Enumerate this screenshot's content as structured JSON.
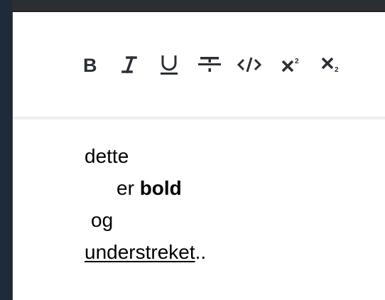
{
  "toolbar": {
    "buttons": [
      {
        "name": "bold",
        "icon": "bold-icon"
      },
      {
        "name": "italic",
        "icon": "italic-icon"
      },
      {
        "name": "underline",
        "icon": "underline-icon"
      },
      {
        "name": "strikethrough",
        "icon": "strikethrough-icon"
      },
      {
        "name": "code",
        "icon": "code-icon"
      },
      {
        "name": "superscript",
        "icon": "superscript-icon"
      },
      {
        "name": "subscript",
        "icon": "subscript-icon"
      }
    ],
    "icon_color": "#2b2f36"
  },
  "document": {
    "line1": "dette",
    "line2_prefix": "er ",
    "line2_bold": "bold",
    "line3": "og",
    "line4_underlined": "understreket",
    "line4_suffix": ".."
  }
}
